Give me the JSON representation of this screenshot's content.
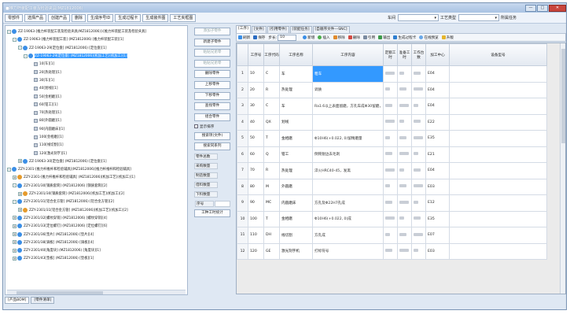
{
  "window": {
    "title": "■推力杆装配工装及检验夹具(MZ1812006)",
    "controls": [
      "—",
      "□",
      "✕"
    ]
  },
  "toolbar": {
    "buttons": [
      "零部件",
      "选择产品",
      "创建产品",
      "删除",
      "生成序号ID",
      "生成过程卡",
      "生成装件图",
      "工艺夹框图"
    ],
    "workshop_label": "车间",
    "workshop_value": "",
    "process_type_label": "工艺类型",
    "process_type_value": "",
    "task_label": "所属任务"
  },
  "tree": {
    "rows": [
      {
        "indent": 0,
        "exp": "-",
        "icon": "blue",
        "label": "ZZ-19063-[推力杆装配工装及检验夹具(MZ1812006)]-[推力杆装配工装及检验夹具]",
        "selected": false
      },
      {
        "indent": 1,
        "exp": "-",
        "icon": "blue",
        "label": "ZZ-19063-[推力杆装配工装] (MZ1812006) [推力杆装配工装][1]",
        "selected": false
      },
      {
        "indent": 2,
        "exp": "-",
        "icon": "blue",
        "label": "ZZ-19063-29[定位盘] (MZ1812006) [定位盘][1]",
        "selected": false
      },
      {
        "indent": 3,
        "exp": "-",
        "icon": "blue",
        "label": "ZZ-19063-29[定位盘] (MZ1812006)[机加工艺](机加工)[1]",
        "selected": true
      },
      {
        "indent": 4,
        "exp": "",
        "icon": "sq",
        "label": "10[车][1]",
        "selected": false
      },
      {
        "indent": 4,
        "exp": "",
        "icon": "sq",
        "label": "20[热处理][1]",
        "selected": false
      },
      {
        "indent": 4,
        "exp": "",
        "icon": "sq",
        "label": "30[车][1]",
        "selected": false
      },
      {
        "indent": 4,
        "exp": "",
        "icon": "sq",
        "label": "40[划线][1]",
        "selected": false
      },
      {
        "indent": 4,
        "exp": "",
        "icon": "sq",
        "label": "50[金相磨][1]",
        "selected": false
      },
      {
        "indent": 4,
        "exp": "",
        "icon": "sq",
        "label": "60[钳工][1]",
        "selected": false
      },
      {
        "indent": 4,
        "exp": "",
        "icon": "sq",
        "label": "70[热处理][1]",
        "selected": false
      },
      {
        "indent": 4,
        "exp": "",
        "icon": "sq",
        "label": "80[外圆磨][1]",
        "selected": false
      },
      {
        "indent": 4,
        "exp": "",
        "icon": "sq",
        "label": "90[内圆磨床][1]",
        "selected": false
      },
      {
        "indent": 4,
        "exp": "",
        "icon": "sq",
        "label": "100[金相磨][1]",
        "selected": false
      },
      {
        "indent": 4,
        "exp": "",
        "icon": "sq",
        "label": "110[线切割][1]",
        "selected": false
      },
      {
        "indent": 4,
        "exp": "",
        "icon": "sq",
        "label": "120[激光刻字][1]",
        "selected": false
      },
      {
        "indent": 2,
        "exp": "+",
        "icon": "blue",
        "label": "ZZ-19063-30[定位盘] (MZ1812006) [定位盘][1]",
        "selected": false
      },
      {
        "indent": 0,
        "exp": "-",
        "icon": "blue",
        "label": "ZZY-2301-[推力杆推杆和检验辅具](MZ1812006)[推力杆推杆和检验辅具]",
        "selected": false
      },
      {
        "indent": 1,
        "exp": "+",
        "icon": "orange",
        "label": "ZZY-2301-[推力杆推杆和检验辅具] (MZ1812006)[机加工艺](机加工)[1]",
        "selected": false
      },
      {
        "indent": 1,
        "exp": "-",
        "icon": "blue",
        "label": "ZZY-2301/30[钢质套筒] (MZ1812006) [钢质套筒][2]",
        "selected": false
      },
      {
        "indent": 2,
        "exp": "+",
        "icon": "orange",
        "label": "ZZY-2301/30[钢质套筒] (MZ1812006)[机加工艺](机加工)[2]",
        "selected": false
      },
      {
        "indent": 1,
        "exp": "-",
        "icon": "blue",
        "label": "ZZY-2301/31[铝合金方管] (MZ1812006) [铝合金方管][2]",
        "selected": false
      },
      {
        "indent": 2,
        "exp": "+",
        "icon": "orange",
        "label": "ZZY-2301/31[铝合金方管] (MZ1812006)[机加工艺](机加工)[2]",
        "selected": false
      },
      {
        "indent": 1,
        "exp": "+",
        "icon": "blue",
        "label": "ZZY-2301/32[螺纹穿销] (MZ1812006) [螺纹穿销][4]",
        "selected": false
      },
      {
        "indent": 1,
        "exp": "+",
        "icon": "blue",
        "label": "ZZY-2301/33[定位螺钉] (MZ1812006) [定位螺钉][6]",
        "selected": false
      },
      {
        "indent": 1,
        "exp": "+",
        "icon": "blue",
        "label": "ZZY-2301/36[垫片] (MZ1812006) [垫片][4]",
        "selected": false
      },
      {
        "indent": 1,
        "exp": "+",
        "icon": "blue",
        "label": "ZZY-2301/38[调板] (MZ1812006) [调板][4]",
        "selected": false
      },
      {
        "indent": 1,
        "exp": "+",
        "icon": "blue",
        "label": "ZZY-2301/40[角度块] (MZ1812006) [角度块][1]",
        "selected": false
      },
      {
        "indent": 1,
        "exp": "+",
        "icon": "blue",
        "label": "ZZY-2301/43[垫板] (MZ1812006) [垫板][1]",
        "selected": false
      }
    ]
  },
  "mid": {
    "buttons": [
      {
        "label": "添加子零件",
        "disabled": true
      },
      {
        "label": "新建子零件",
        "disabled": false
      },
      {
        "label": "粘贴兄弟零",
        "disabled": true
      },
      {
        "label": "粘贴兄弟零",
        "disabled": true
      },
      {
        "label": "删除零件",
        "disabled": false
      },
      {
        "label": "上移零件",
        "disabled": false
      },
      {
        "label": "下移零件",
        "disabled": false
      },
      {
        "label": "查找零件",
        "disabled": false
      },
      {
        "label": "组合零件",
        "disabled": false
      }
    ],
    "checkbox_label": "显示排序",
    "buttons2": [
      {
        "label": "搜索项(文件)",
        "disabled": false
      },
      {
        "label": "搜索同系列",
        "disabled": false
      }
    ],
    "label_stats": "零件总数",
    "labels": [
      "采购数量",
      "制造数量",
      "借料数量",
      "下料数量"
    ],
    "seq_label": "序号",
    "workhour_button": "工种工时统计"
  },
  "tabs": [
    "[工序]",
    "[文件]",
    "[引用零件]",
    "[装配任务]",
    "[自顺序文件---SNC]"
  ],
  "grid_toolbar": {
    "items": [
      "刷新",
      "保存",
      "步长:",
      "新增",
      "插入",
      "移除",
      "删除",
      "引用",
      "输出",
      "生成过程卡",
      "在线预览",
      "升版"
    ],
    "step_value": "10"
  },
  "grid": {
    "headers": [
      "工序号",
      "工序代码",
      "工序名称",
      "工序内容",
      "定额工时",
      "准备工时",
      "工作台数",
      "加工中心",
      "设备型号"
    ],
    "rows": [
      {
        "no": "1",
        "seq": "10",
        "code": "C",
        "name": "车",
        "content": "粗车",
        "center": "E04",
        "hl": true
      },
      {
        "no": "2",
        "seq": "20",
        "code": "R",
        "name": "热处理",
        "content": "调质",
        "center": "E04",
        "hl": false
      },
      {
        "no": "3",
        "seq": "30",
        "code": "C",
        "name": "车",
        "content": "Ra1.6以上表面留磨，方孔车成Φ30留磨，余序按图",
        "center": "E04",
        "hl": false
      },
      {
        "no": "4",
        "seq": "40",
        "code": "QX",
        "name": "划线",
        "content": "",
        "center": "E22",
        "hl": false
      },
      {
        "no": "5",
        "seq": "50",
        "code": "T",
        "name": "金相磨",
        "content": "Φ10H6(+0.022, 0)留精磨量",
        "center": "E35",
        "hl": false
      },
      {
        "no": "6",
        "seq": "60",
        "q": "",
        "code": "Q",
        "name": "钳工",
        "content": "倒钝锐边去毛刺",
        "center": "E21",
        "hl": false
      },
      {
        "no": "7",
        "seq": "70",
        "code": "R",
        "name": "热处理",
        "content": "淬火HRC40-45，发黑",
        "center": "E04",
        "hl": false
      },
      {
        "no": "8",
        "seq": "80",
        "code": "M",
        "name": "外圆磨",
        "content": "",
        "center": "E03",
        "hl": false
      },
      {
        "no": "9",
        "seq": "90",
        "code": "MC",
        "name": "内圆磨床",
        "content": "方孔及Φ22H7孔成",
        "center": "E12",
        "hl": false
      },
      {
        "no": "10",
        "seq": "100",
        "code": "T",
        "name": "金相磨",
        "content": "Φ10H6(+0.022, 0)成",
        "center": "E35",
        "hl": false
      },
      {
        "no": "11",
        "seq": "110",
        "code": "DH",
        "name": "线切割",
        "content": "方孔成",
        "center": "E07",
        "hl": false
      },
      {
        "no": "12",
        "seq": "120",
        "code": "GE",
        "name": "激光刻字机",
        "content": "打标符号",
        "center": "E03",
        "hl": false
      }
    ]
  },
  "bottom_tabs": [
    "[产品BOM]",
    "[零件清单]"
  ],
  "colors": {
    "selection": "#3399ff",
    "title_bar": "#a9c3e3",
    "close": "#c9463d"
  }
}
